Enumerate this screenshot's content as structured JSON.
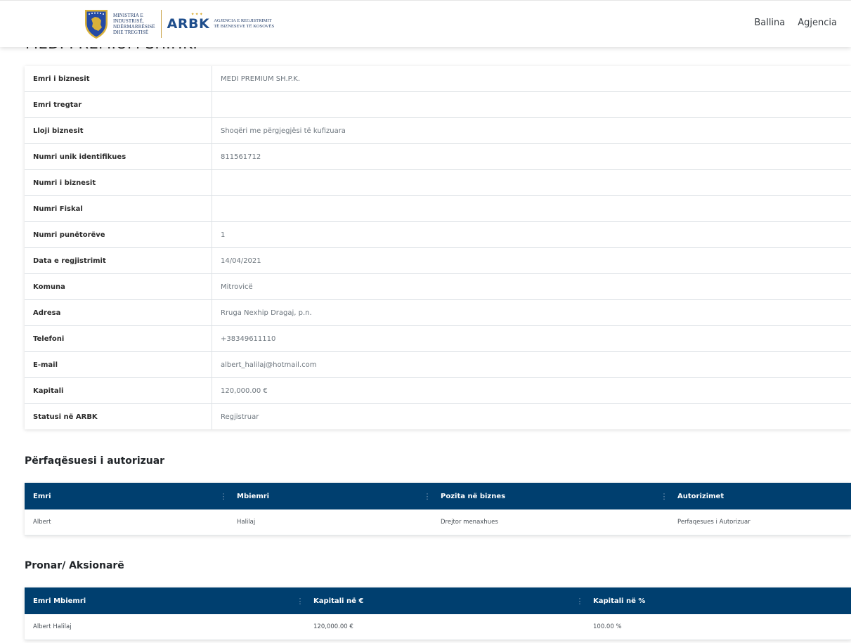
{
  "header": {
    "ministry_lines": [
      "MINISTRIA E",
      "INDUSTRISË,",
      "NDËRMARRËSISË",
      "DHE TREGTISË"
    ],
    "arbk_word": "ARBK",
    "agency_lines": [
      "AGJENCIA E REGJISTRIMIT",
      "TË BIZNESEVE TË KOSOVËS"
    ],
    "nav": [
      {
        "label": "Ballina"
      },
      {
        "label": "Agjencia"
      }
    ]
  },
  "page_title": "MEDI PREMIUM SH.P.K.",
  "info": [
    {
      "label": "Emri i biznesit",
      "value": "MEDI PREMIUM SH.P.K."
    },
    {
      "label": "Emri tregtar",
      "value": ""
    },
    {
      "label": "Lloji biznesit",
      "value": "Shoqëri me përgjegjësi të kufizuara"
    },
    {
      "label": "Numri unik identifikues",
      "value": "811561712"
    },
    {
      "label": "Numri i biznesit",
      "value": ""
    },
    {
      "label": "Numri Fiskal",
      "value": ""
    },
    {
      "label": "Numri punëtorëve",
      "value": "1"
    },
    {
      "label": "Data e regjistrimit",
      "value": "14/04/2021"
    },
    {
      "label": "Komuna",
      "value": "Mitrovicë"
    },
    {
      "label": "Adresa",
      "value": "Rruga Nexhip Dragaj, p.n."
    },
    {
      "label": "Telefoni",
      "value": "+38349611110"
    },
    {
      "label": "E-mail",
      "value": "albert_halilaj@hotmail.com"
    },
    {
      "label": "Kapitali",
      "value": "120,000.00 €"
    },
    {
      "label": "Statusi në ARBK",
      "value": "Regjistruar"
    }
  ],
  "representatives": {
    "title": "Përfaqësuesi i autorizuar",
    "columns": [
      "Emri",
      "Mbiemri",
      "Pozita në biznes",
      "Autorizimet"
    ],
    "rows": [
      [
        "Albert",
        "Halilaj",
        "Drejtor menaxhues",
        "Perfaqesues i Autorizuar"
      ]
    ]
  },
  "owners": {
    "title": "Pronar/ Aksionarë",
    "columns": [
      "Emri Mbiemri",
      "Kapitali në €",
      "Kapitali në %"
    ],
    "rows": [
      [
        "Albert Halilaj",
        "120,000.00 €",
        "100.00 %"
      ]
    ]
  },
  "colors": {
    "grid_header": "#003f6f",
    "brand_blue": "#1f4e8c",
    "gold": "#c9a247"
  },
  "icons": {
    "seal": "kosovo-coat-of-arms-icon",
    "column_menu": "kebab-menu-icon"
  }
}
